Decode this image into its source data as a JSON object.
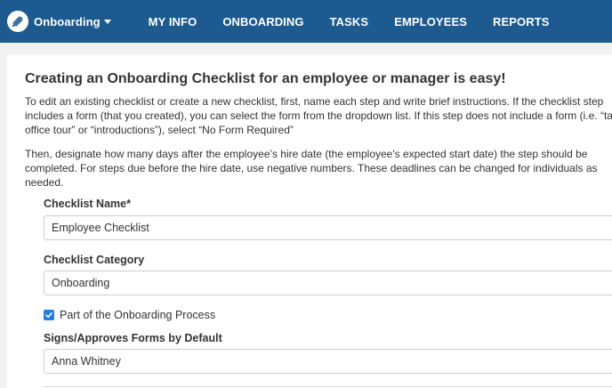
{
  "nav": {
    "brand_label": "Onboarding",
    "items": [
      "MY INFO",
      "ONBOARDING",
      "TASKS",
      "EMPLOYEES",
      "REPORTS"
    ]
  },
  "colors": {
    "nav_bg": "#1c5a8f",
    "checkbox": "#1f7fe3"
  },
  "page": {
    "title": "Creating an Onboarding Checklist for an employee or manager is easy!",
    "paragraph1": "To edit an existing checklist or create a new checklist, first, name each step and write brief instructions. If the checklist step includes a form (that you created), you can select the form from the dropdown list. If this step does not include a form (i.e. “take office tour” or “introductions”), select “No Form Required”",
    "paragraph2": "Then, designate how many days after the employee’s hire date (the employee's expected start date) the step should be completed. For steps due before the hire date, use negative numbers. These deadlines can be changed for individuals as needed."
  },
  "form": {
    "checklist_name_label": "Checklist Name*",
    "checklist_name_value": "Employee Checklist",
    "checklist_category_label": "Checklist Category",
    "checklist_category_value": "Onboarding",
    "onboarding_process_label": "Part of the Onboarding Process",
    "onboarding_process_checked": true,
    "signs_approves_label": "Signs/Approves Forms by Default",
    "signs_approves_value": "Anna Whitney"
  }
}
